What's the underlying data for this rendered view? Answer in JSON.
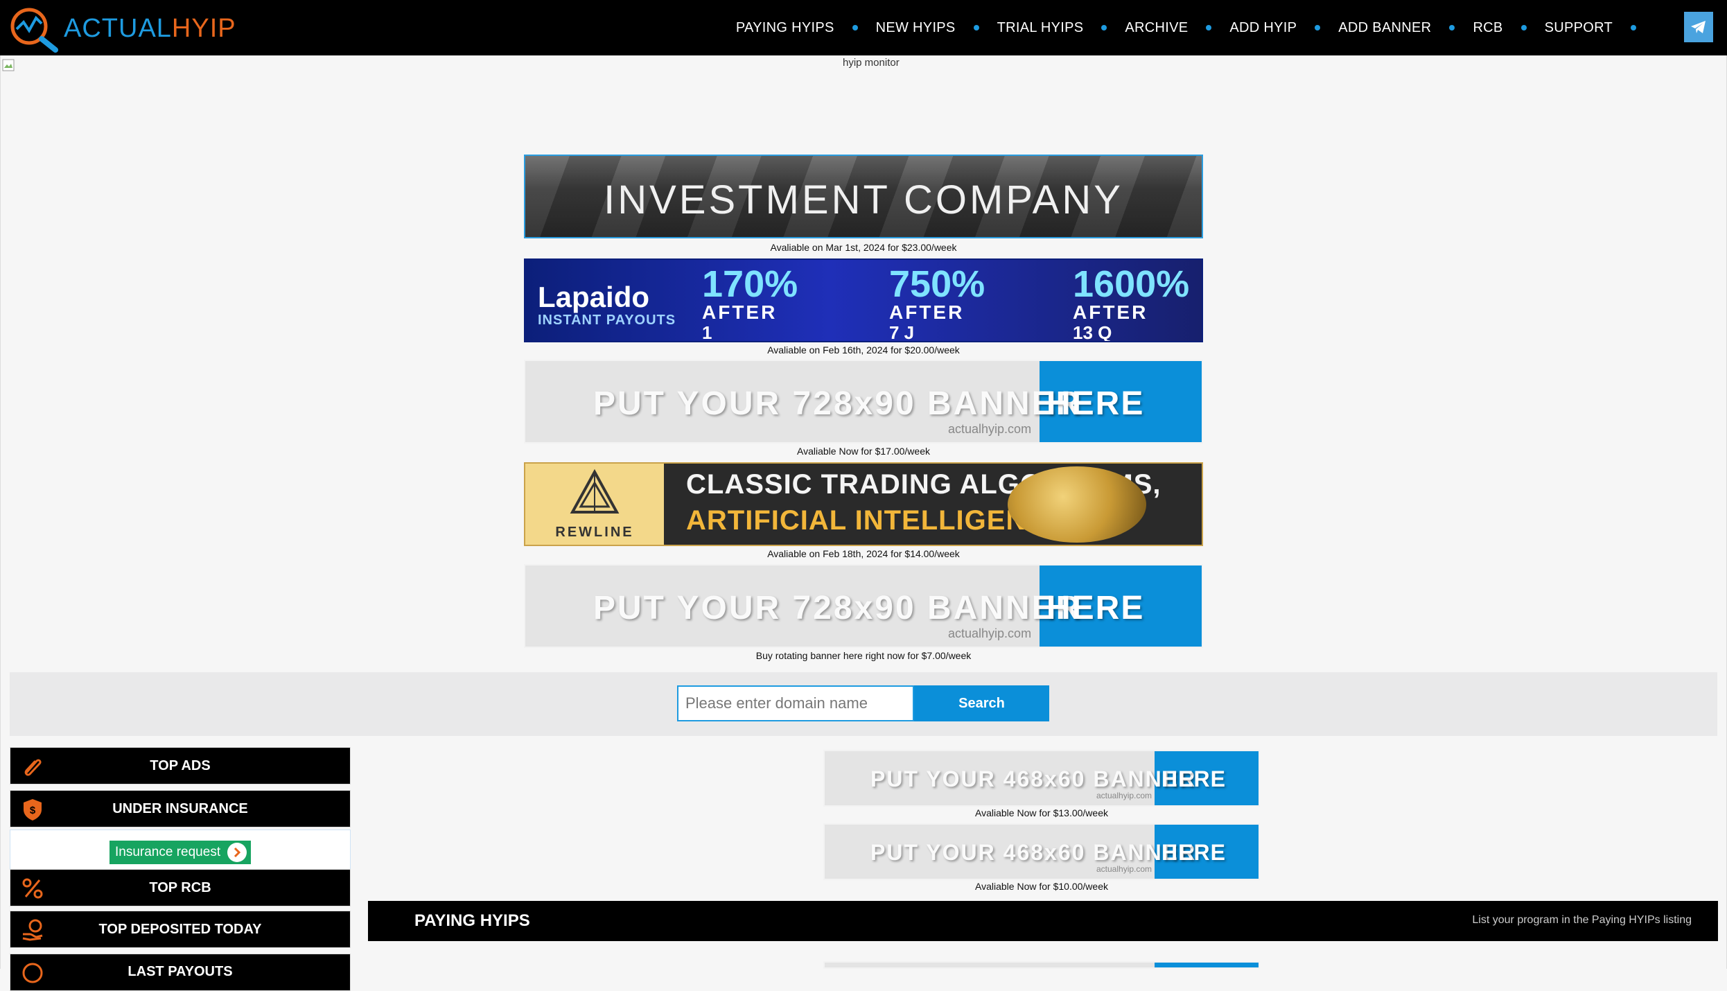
{
  "brand": {
    "part1": "ACTUAL",
    "part2": "HYIP"
  },
  "nav": {
    "items": [
      {
        "label": "PAYING HYIPS"
      },
      {
        "label": "NEW HYIPS"
      },
      {
        "label": "TRIAL HYIPS"
      },
      {
        "label": "ARCHIVE"
      },
      {
        "label": "ADD HYIP"
      },
      {
        "label": "ADD BANNER"
      },
      {
        "label": "RCB"
      },
      {
        "label": "SUPPORT"
      }
    ],
    "telegram_icon": "telegram-icon"
  },
  "hero": {
    "alt": "hyip monitor"
  },
  "banners": [
    {
      "text": "INVESTMENT COMPANY",
      "caption": "Avaliable on Mar 1st, 2024 for $23.00/week"
    },
    {
      "brand": "Lapaido",
      "sub": "INSTANT PAYOUTS",
      "plans": [
        {
          "pct": "170%",
          "after": "AFTER",
          "day": "1"
        },
        {
          "pct": "750%",
          "after": "AFTER",
          "day": "7 J"
        },
        {
          "pct": "1600%",
          "after": "AFTER",
          "day": "13 Q"
        }
      ],
      "caption": "Avaliable on Feb 16th, 2024 for $20.00/week"
    },
    {
      "t1": "PUT YOUR 728x90 BANNER",
      "t2": "HERE",
      "site": "actualhyip.com",
      "caption": "Avaliable Now for $17.00/week"
    },
    {
      "name": "REWLINE",
      "line1": "CLASSIC TRADING ALGORITHMS,",
      "line2": "ARTIFICIAL INTELLIGENCE ON",
      "caption": "Avaliable on Feb 18th, 2024 for $14.00/week"
    },
    {
      "t1": "PUT YOUR 728x90 BANNER",
      "t2": "HERE",
      "site": "actualhyip.com",
      "caption": "Buy rotating banner here right now for $7.00/week"
    }
  ],
  "search": {
    "placeholder": "Please enter domain name",
    "button": "Search"
  },
  "sidebar": {
    "items": [
      {
        "label": "TOP ADS",
        "icon": "paperclip-icon"
      },
      {
        "label": "UNDER INSURANCE",
        "icon": "shield-dollar-icon"
      },
      {
        "label": "TOP RCB",
        "icon": "percent-icon"
      },
      {
        "label": "TOP DEPOSITED TODAY",
        "icon": "hand-coins-icon"
      },
      {
        "label": "LAST PAYOUTS",
        "icon": "dollar-circle-icon"
      }
    ],
    "insurance_button": "Insurance request"
  },
  "small_banners": [
    {
      "t1": "PUT YOUR 468x60 BANNER",
      "t2": "HERE",
      "site": "actualhyip.com",
      "caption": "Avaliable Now for $13.00/week"
    },
    {
      "t1": "PUT YOUR 468x60 BANNER",
      "t2": "HERE",
      "site": "actualhyip.com",
      "caption": "Avaliable Now for $10.00/week"
    }
  ],
  "paying": {
    "title": "PAYING HYIPS",
    "link": "List your program in the Paying HYIPs listing"
  },
  "colors": {
    "accent_blue": "#1e9be0",
    "accent_orange": "#e8661c",
    "green": "#17a460",
    "banner_blue": "#0b8fd9"
  }
}
